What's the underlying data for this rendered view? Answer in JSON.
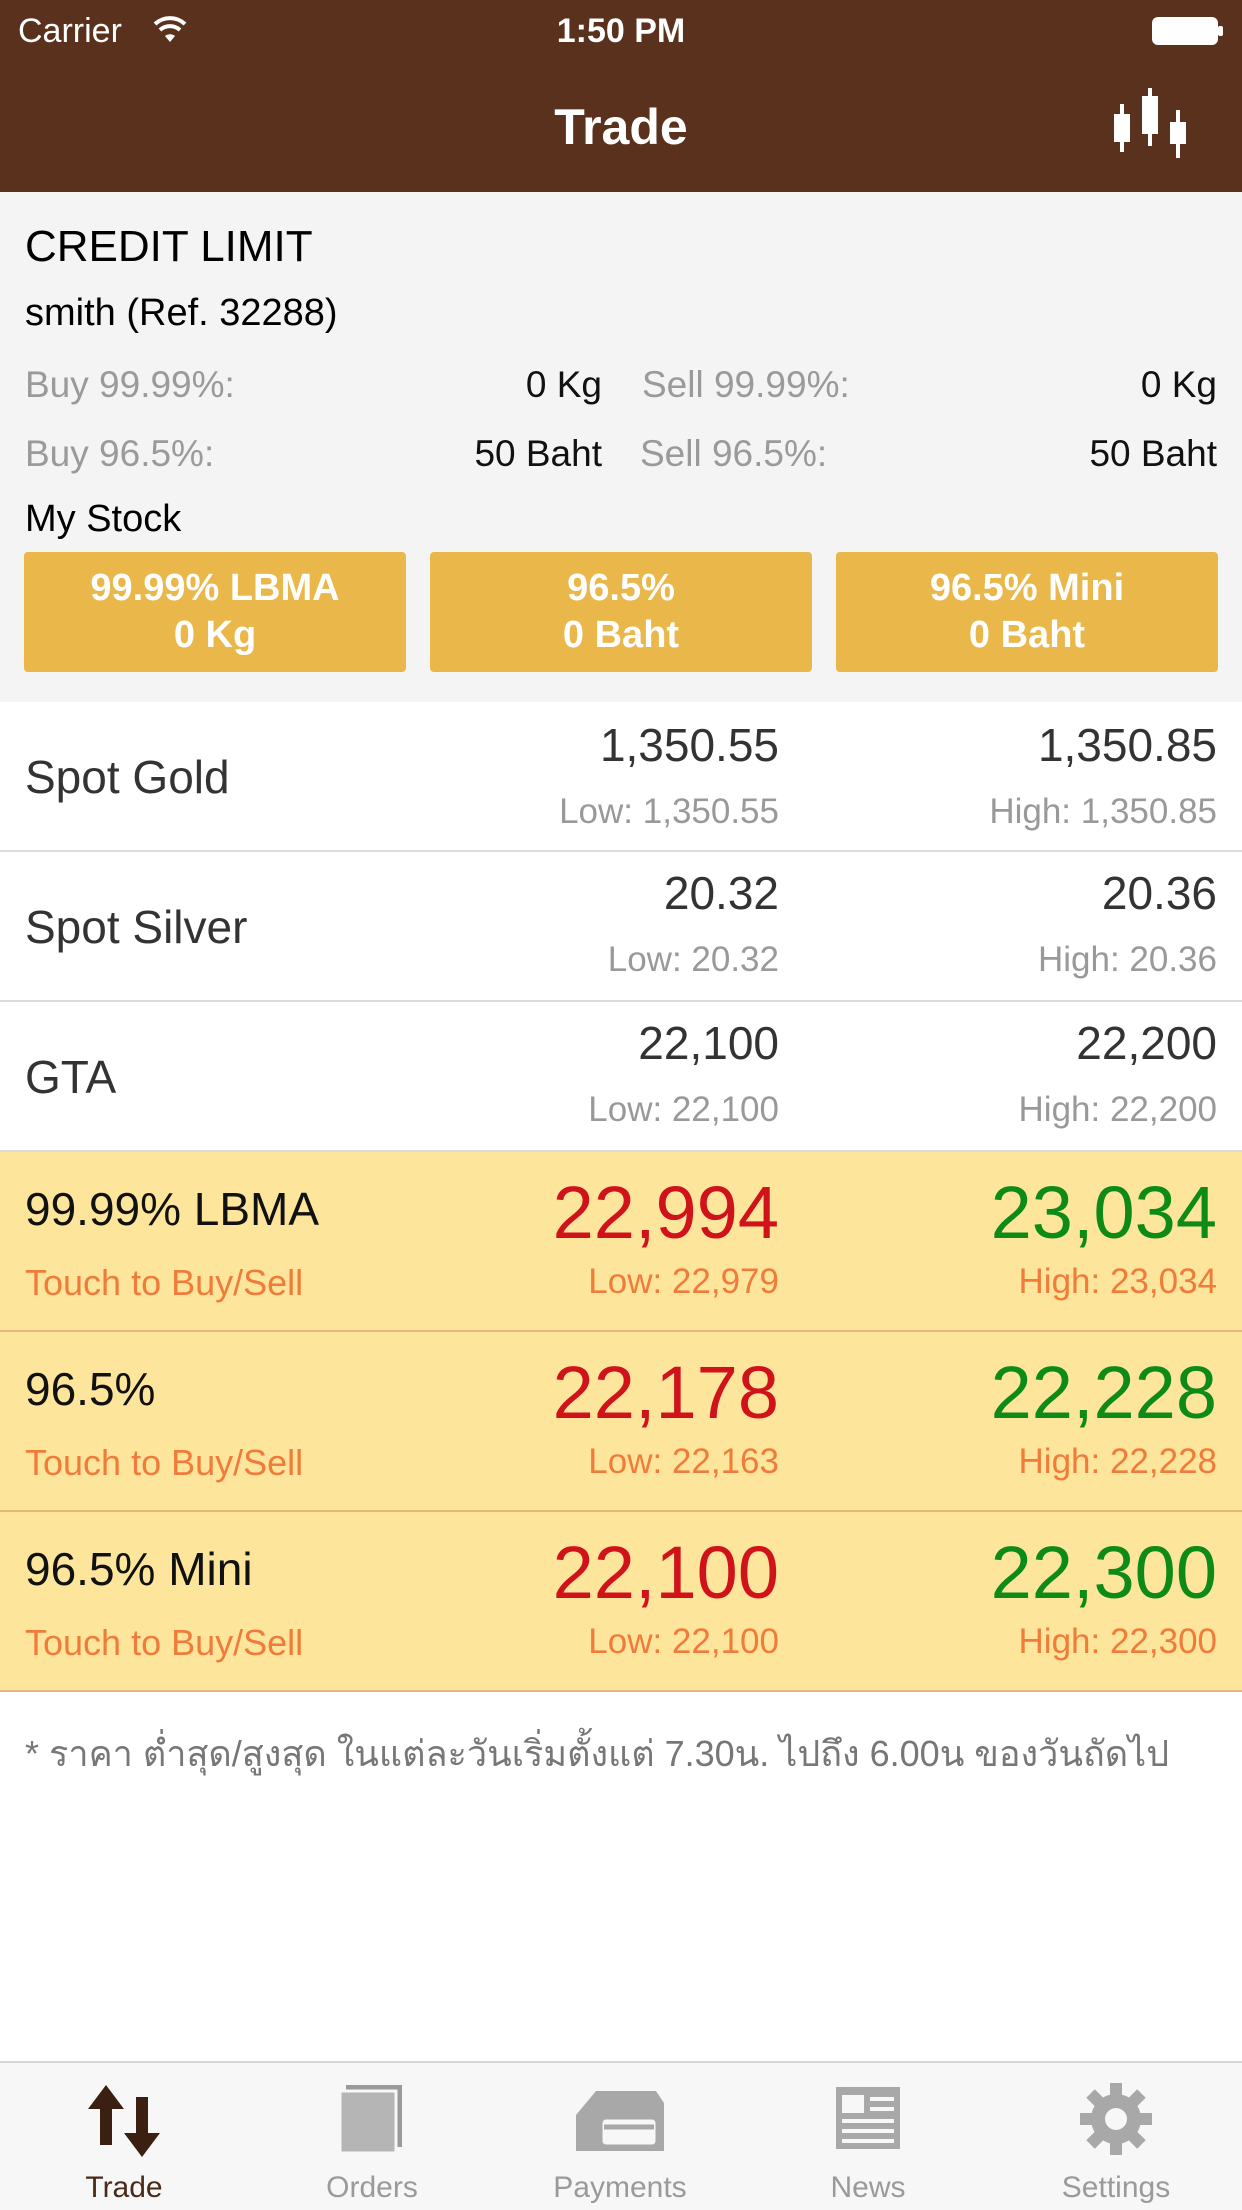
{
  "status_bar": {
    "carrier": "Carrier",
    "time": "1:50 PM"
  },
  "nav": {
    "title": "Trade",
    "chart_icon": "candlestick-chart-icon"
  },
  "credit": {
    "heading": "CREDIT LIMIT",
    "user": "smith (Ref. 32288)",
    "limits": [
      {
        "label": "Buy 99.99%:",
        "value": "0 Kg"
      },
      {
        "label": "Sell 99.99%:",
        "value": "0 Kg"
      },
      {
        "label": "Buy 96.5%:",
        "value": "50 Baht"
      },
      {
        "label": "Sell 96.5%:",
        "value": "50 Baht"
      }
    ],
    "my_stock_label": "My Stock",
    "stock": [
      {
        "name": "99.99% LBMA",
        "amount": "0 Kg"
      },
      {
        "name": "96.5%",
        "amount": "0 Baht"
      },
      {
        "name": "96.5% Mini",
        "amount": "0 Baht"
      }
    ]
  },
  "spot_rows": [
    {
      "name": "Spot Gold",
      "bid": "1,350.55",
      "ask": "1,350.85",
      "low": "Low: 1,350.55",
      "high": "High: 1,350.85"
    },
    {
      "name": "Spot Silver",
      "bid": "20.32",
      "ask": "20.36",
      "low": "Low: 20.32",
      "high": "High: 20.36"
    },
    {
      "name": "GTA",
      "bid": "22,100",
      "ask": "22,200",
      "low": "Low: 22,100",
      "high": "High: 22,200"
    }
  ],
  "trade_rows": [
    {
      "name": "99.99% LBMA",
      "touch": "Touch to Buy/Sell",
      "buy": "22,994",
      "sell": "23,034",
      "low": "Low: 22,979",
      "high": "High: 23,034"
    },
    {
      "name": "96.5%",
      "touch": "Touch to Buy/Sell",
      "buy": "22,178",
      "sell": "22,228",
      "low": "Low: 22,163",
      "high": "High: 22,228"
    },
    {
      "name": "96.5% Mini",
      "touch": "Touch to Buy/Sell",
      "buy": "22,100",
      "sell": "22,300",
      "low": "Low: 22,100",
      "high": "High: 22,300"
    }
  ],
  "footnote": "* ราคา ต่ำสุด/สูงสุด ในแต่ละวันเริ่มตั้งแต่ 7.30น. ไปถึง 6.00น ของวันถัดไป",
  "tabs": [
    {
      "label": "Trade",
      "icon": "buy-sell-arrows-icon",
      "active": true
    },
    {
      "label": "Orders",
      "icon": "orders-icon",
      "active": false
    },
    {
      "label": "Payments",
      "icon": "payments-icon",
      "active": false
    },
    {
      "label": "News",
      "icon": "news-icon",
      "active": false
    },
    {
      "label": "Settings",
      "icon": "gear-icon",
      "active": false
    }
  ],
  "colors": {
    "header": "#5a311d",
    "stock_button": "#e9b74a",
    "trade_row": "#fde69c",
    "buy": "#d0121b",
    "sell": "#0e8a16",
    "accent_text": "#f07b3a"
  }
}
